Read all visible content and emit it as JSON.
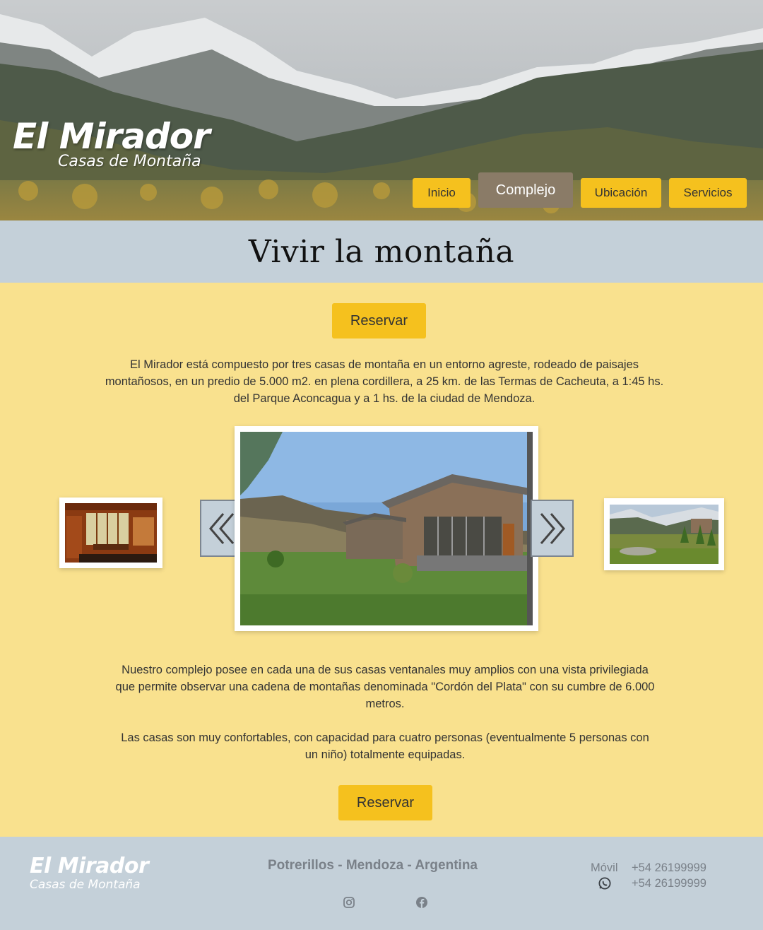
{
  "header": {
    "brand_title": "El Mirador",
    "brand_subtitle": "Casas de Montaña",
    "nav": [
      {
        "label": "Inicio",
        "active": false
      },
      {
        "label": "Complejo",
        "active": true
      },
      {
        "label": "Ubicación",
        "active": false
      },
      {
        "label": "Servicios",
        "active": false
      }
    ]
  },
  "main": {
    "title": "Vivir la montaña",
    "reserve_label": "Reservar",
    "intro": "El Mirador está compuesto por tres casas de montaña en un entorno agreste, rodeado de paisajes montañosos, en un predio de 5.000 m2. en plena cordillera, a 25 km. de las Termas de Cacheuta, a 1:45 hs. del Parque Aconcagua y a 1 hs. de la ciudad de Mendoza.",
    "para_2": "Nuestro complejo posee en cada una de sus casas ventanales muy amplios con una vista privilegiada que permite observar una cadena de montañas denominada \"Cordón del Plata\" con su cumbre de 6.000 metros.",
    "para_3": "Las casas son muy confortables, con capacidad para cuatro personas (eventualmente 5 personas con un niño) totalmente equipadas."
  },
  "carousel": {
    "prev_icon": "double-chevron-left-icon",
    "next_icon": "double-chevron-right-icon"
  },
  "footer": {
    "brand_title": "El Mirador",
    "brand_subtitle": "Casas de Montaña",
    "location": "Potrerillos - Mendoza - Argentina",
    "mobile_label": "Móvil",
    "mobile_number": "+54 26199999",
    "whatsapp_number": "+54 26199999"
  },
  "colors": {
    "accent": "#f5c11e",
    "active_nav": "#8a7b67",
    "band": "#c4d0d9",
    "body_bg": "#f9e18e"
  }
}
